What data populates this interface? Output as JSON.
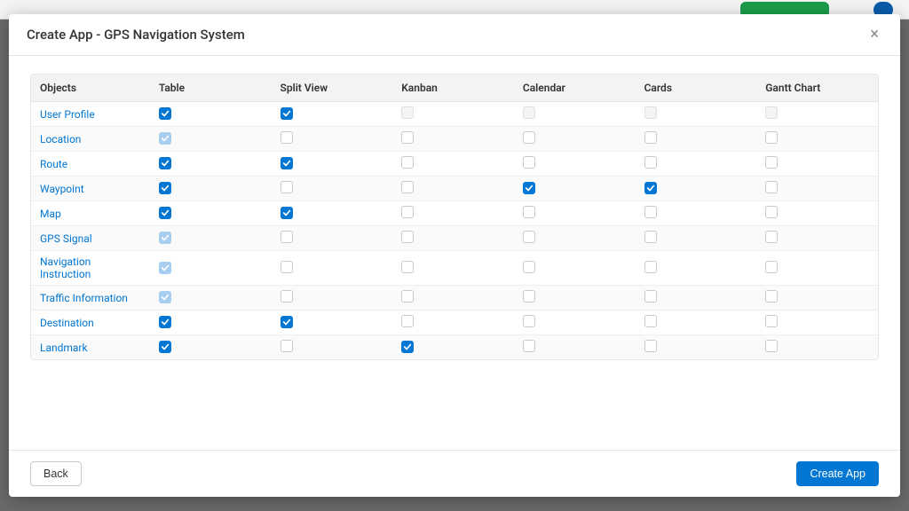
{
  "modal": {
    "title": "Create App - GPS Navigation System",
    "close_symbol": "×"
  },
  "columns": [
    "Objects",
    "Table",
    "Split View",
    "Kanban",
    "Calendar",
    "Cards",
    "Gantt Chart"
  ],
  "rows": [
    {
      "name": "User Profile",
      "cells": [
        {
          "checked": true,
          "disabled": false
        },
        {
          "checked": true,
          "disabled": false
        },
        {
          "checked": false,
          "disabled": true
        },
        {
          "checked": false,
          "disabled": true
        },
        {
          "checked": false,
          "disabled": true
        },
        {
          "checked": false,
          "disabled": true
        }
      ]
    },
    {
      "name": "Location",
      "cells": [
        {
          "checked": true,
          "disabled": true
        },
        {
          "checked": false,
          "disabled": false
        },
        {
          "checked": false,
          "disabled": false
        },
        {
          "checked": false,
          "disabled": false
        },
        {
          "checked": false,
          "disabled": false
        },
        {
          "checked": false,
          "disabled": false
        }
      ]
    },
    {
      "name": "Route",
      "cells": [
        {
          "checked": true,
          "disabled": false
        },
        {
          "checked": true,
          "disabled": false
        },
        {
          "checked": false,
          "disabled": false
        },
        {
          "checked": false,
          "disabled": false
        },
        {
          "checked": false,
          "disabled": false
        },
        {
          "checked": false,
          "disabled": false
        }
      ]
    },
    {
      "name": "Waypoint",
      "cells": [
        {
          "checked": true,
          "disabled": false
        },
        {
          "checked": false,
          "disabled": false
        },
        {
          "checked": false,
          "disabled": false
        },
        {
          "checked": true,
          "disabled": false
        },
        {
          "checked": true,
          "disabled": false
        },
        {
          "checked": false,
          "disabled": false
        }
      ]
    },
    {
      "name": "Map",
      "cells": [
        {
          "checked": true,
          "disabled": false
        },
        {
          "checked": true,
          "disabled": false
        },
        {
          "checked": false,
          "disabled": false
        },
        {
          "checked": false,
          "disabled": false
        },
        {
          "checked": false,
          "disabled": false
        },
        {
          "checked": false,
          "disabled": false
        }
      ]
    },
    {
      "name": "GPS Signal",
      "cells": [
        {
          "checked": true,
          "disabled": true
        },
        {
          "checked": false,
          "disabled": false
        },
        {
          "checked": false,
          "disabled": false
        },
        {
          "checked": false,
          "disabled": false
        },
        {
          "checked": false,
          "disabled": false
        },
        {
          "checked": false,
          "disabled": false
        }
      ]
    },
    {
      "name": "Navigation Instruction",
      "cells": [
        {
          "checked": true,
          "disabled": true
        },
        {
          "checked": false,
          "disabled": false
        },
        {
          "checked": false,
          "disabled": false
        },
        {
          "checked": false,
          "disabled": false
        },
        {
          "checked": false,
          "disabled": false
        },
        {
          "checked": false,
          "disabled": false
        }
      ]
    },
    {
      "name": "Traffic Information",
      "cells": [
        {
          "checked": true,
          "disabled": true
        },
        {
          "checked": false,
          "disabled": false
        },
        {
          "checked": false,
          "disabled": false
        },
        {
          "checked": false,
          "disabled": false
        },
        {
          "checked": false,
          "disabled": false
        },
        {
          "checked": false,
          "disabled": false
        }
      ]
    },
    {
      "name": "Destination",
      "cells": [
        {
          "checked": true,
          "disabled": false
        },
        {
          "checked": true,
          "disabled": false
        },
        {
          "checked": false,
          "disabled": false
        },
        {
          "checked": false,
          "disabled": false
        },
        {
          "checked": false,
          "disabled": false
        },
        {
          "checked": false,
          "disabled": false
        }
      ]
    },
    {
      "name": "Landmark",
      "cells": [
        {
          "checked": true,
          "disabled": false
        },
        {
          "checked": false,
          "disabled": false
        },
        {
          "checked": true,
          "disabled": false
        },
        {
          "checked": false,
          "disabled": false
        },
        {
          "checked": false,
          "disabled": false
        },
        {
          "checked": false,
          "disabled": false
        }
      ]
    }
  ],
  "footer": {
    "back_label": "Back",
    "create_label": "Create App"
  }
}
